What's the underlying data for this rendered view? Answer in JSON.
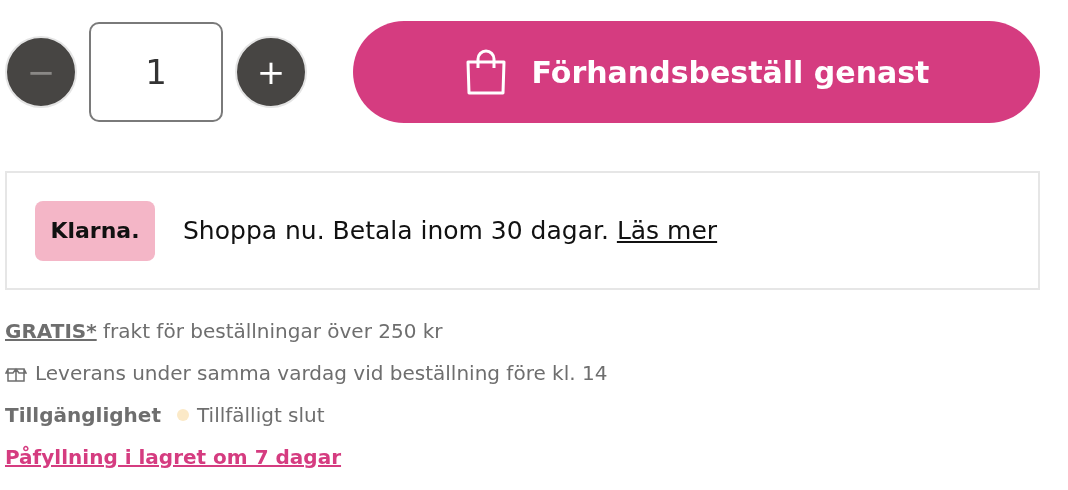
{
  "quantity": {
    "value": "1",
    "decrease": {
      "label": "−",
      "disabled": true
    },
    "increase": {
      "label": "+",
      "disabled": false
    }
  },
  "order_button": {
    "label": "Förhandsbeställ genast"
  },
  "klarna": {
    "logo": "Klarna.",
    "text": "Shoppa nu. Betala inom 30 dagar.",
    "link": "Läs mer"
  },
  "shipping": {
    "link": "GRATIS*",
    "text": "frakt för beställningar över 250 kr"
  },
  "delivery": {
    "text": "Leverans under samma vardag vid beställning före kl. 14"
  },
  "availability": {
    "label": "Tillgänglighet",
    "status": "Tillfälligt slut",
    "color": "#fbe9c7"
  },
  "restock_link": "Påfyllning i lagret om 7 dagar"
}
